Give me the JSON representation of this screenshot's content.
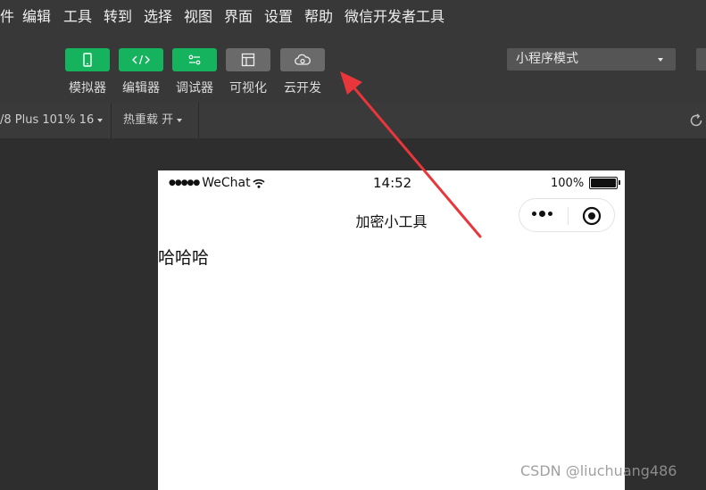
{
  "menubar": {
    "items": [
      "件",
      "编辑",
      "工具",
      "转到",
      "选择",
      "视图",
      "界面",
      "设置",
      "帮助",
      "微信开发者工具"
    ]
  },
  "toolbar": {
    "tools": [
      {
        "label": "模拟器",
        "icon": "phone-icon"
      },
      {
        "label": "编辑器",
        "icon": "code-icon"
      },
      {
        "label": "调试器",
        "icon": "debug-icon"
      },
      {
        "label": "可视化",
        "icon": "layout-icon"
      },
      {
        "label": "云开发",
        "icon": "cloud-icon"
      }
    ],
    "mode_select": {
      "value": "小程序模式"
    },
    "accent_green": "#16b35f"
  },
  "device_bar": {
    "device": "/8 Plus 101% 16",
    "hot_reload": "热重载 开"
  },
  "simulator": {
    "status": {
      "carrier": "WeChat",
      "signal_dots": "●●●●●",
      "time": "14:52",
      "battery": "100%"
    },
    "nav_title": "加密小工具",
    "page_text": "哈哈哈"
  },
  "annotation": {
    "arrow_color": "#e8363b"
  },
  "watermark": "CSDN @liuchuang486"
}
